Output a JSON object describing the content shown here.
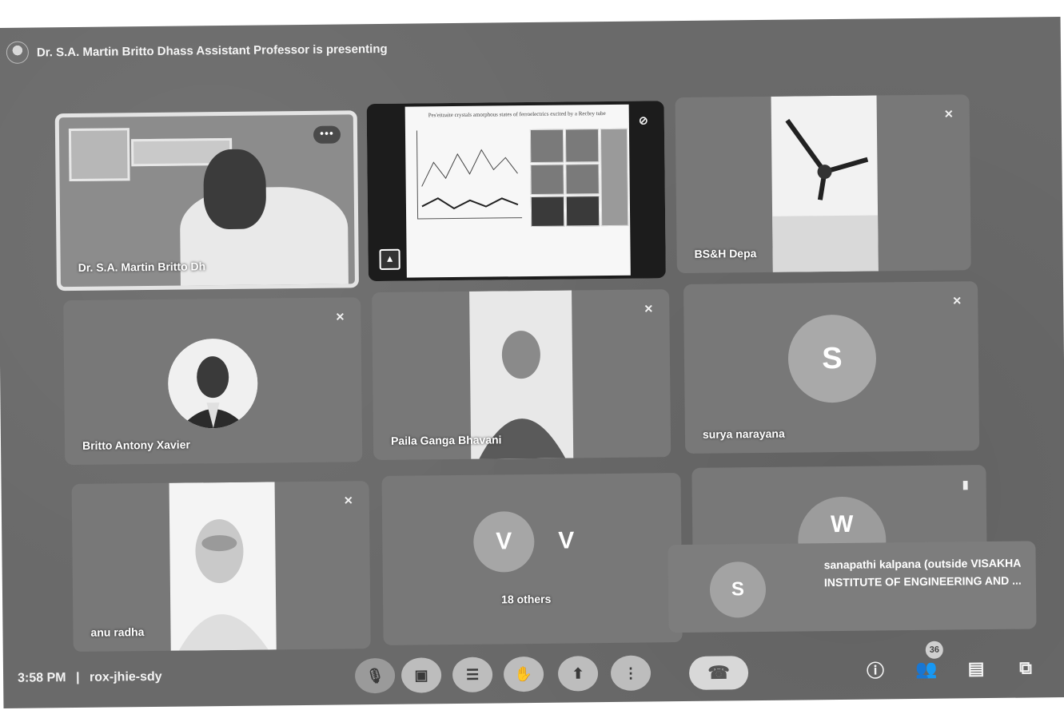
{
  "header": {
    "presenting_text": "Dr. S.A. Martin Britto Dhass Assistant Professor is presenting"
  },
  "tiles": [
    {
      "name": "Dr. S.A. Martin Britto Dh",
      "state": "speaking"
    },
    {
      "name": "",
      "state": "screen-share",
      "slide_title": "Pes'eitzaite crystals amorphous states of ferroelectrics excited by a Recbry tube"
    },
    {
      "name": "BS&H Depa",
      "state": "muted"
    },
    {
      "name": "Britto Antony Xavier",
      "state": "muted"
    },
    {
      "name": "Paila Ganga Bhavani",
      "state": "muted"
    },
    {
      "name": "surya narayana",
      "state": "muted",
      "avatar_letter": "S"
    },
    {
      "name": "anu radha",
      "state": "muted"
    },
    {
      "name": "18 others",
      "state": "group",
      "avatar_letters": [
        "V",
        "V"
      ]
    },
    {
      "name": "",
      "state": "speaking",
      "avatar_letter": "W"
    }
  ],
  "pip": {
    "avatar_letter": "S",
    "label": "sanapathi kalpana (outside VISAKHA INSTITUTE OF ENGINEERING AND ..."
  },
  "bottom_bar": {
    "time": "3:58 PM",
    "separator": "|",
    "meeting_code": "rox-jhie-sdy",
    "participants_badge": "36"
  },
  "colors": {
    "background": "#6a6a6a",
    "tile": "#787878",
    "text": "#ffffff"
  }
}
